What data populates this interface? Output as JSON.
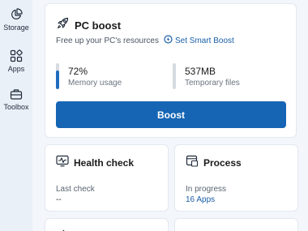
{
  "sidebar": {
    "items": [
      {
        "label": "Storage",
        "icon": "pie-chart-icon"
      },
      {
        "label": "Apps",
        "icon": "apps-grid-icon"
      },
      {
        "label": "Toolbox",
        "icon": "toolbox-icon"
      }
    ]
  },
  "boost": {
    "title": "PC boost",
    "icon": "rocket-icon",
    "subtitle": "Free up your PC's resources",
    "smart_link": "Set Smart Boost",
    "memory": {
      "value": "72%",
      "label": "Memory usage",
      "fill_percent": 72
    },
    "temp": {
      "value": "537MB",
      "label": "Temporary files",
      "fill_percent": 0
    },
    "button_label": "Boost"
  },
  "health": {
    "title": "Health check",
    "icon": "pulse-monitor-icon",
    "meta_label": "Last check",
    "meta_value": "--"
  },
  "process": {
    "title": "Process",
    "icon": "process-window-icon",
    "meta_label": "In progress",
    "meta_value": "16 Apps"
  },
  "colors": {
    "accent": "#1565b4",
    "link": "#1a5fa8",
    "background": "#f3f6fb"
  }
}
